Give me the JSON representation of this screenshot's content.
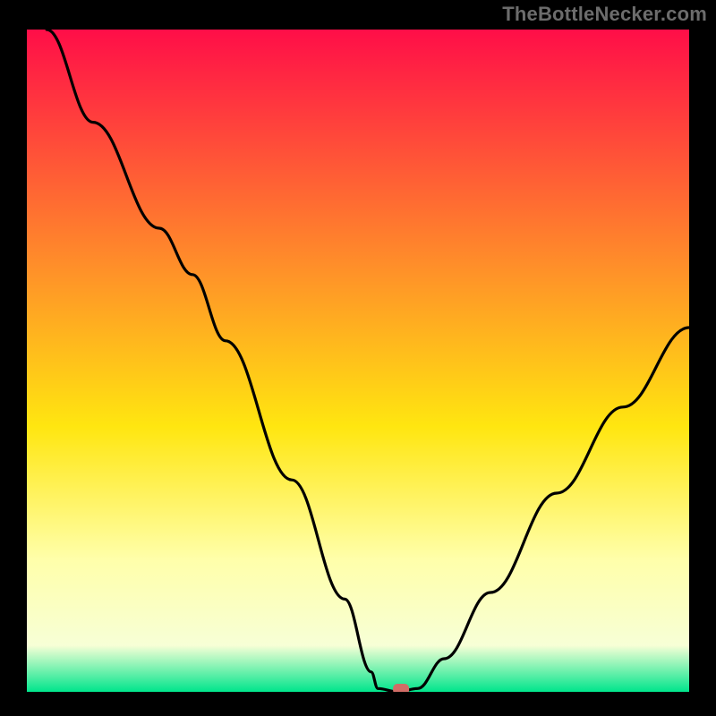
{
  "watermark": "TheBottleNecker.com",
  "colors": {
    "red_top": "#ff0e48",
    "orange": "#ff8c2a",
    "yellow": "#ffe610",
    "pale_yellow": "#ffffaa",
    "cream": "#f7ffd6",
    "green": "#00e58c",
    "curve": "#000000",
    "marker": "#d16c66"
  },
  "chart_data": {
    "type": "line",
    "title": "",
    "xlabel": "",
    "ylabel": "",
    "xlim": [
      0,
      100
    ],
    "ylim": [
      0,
      100
    ],
    "marker": {
      "x": 56.5,
      "y": 0
    },
    "series": [
      {
        "name": "bottleneck-curve",
        "points": [
          {
            "x": 3,
            "y": 100
          },
          {
            "x": 10,
            "y": 86
          },
          {
            "x": 20,
            "y": 70
          },
          {
            "x": 25,
            "y": 63
          },
          {
            "x": 30,
            "y": 53
          },
          {
            "x": 40,
            "y": 32
          },
          {
            "x": 48,
            "y": 14
          },
          {
            "x": 52,
            "y": 3
          },
          {
            "x": 53,
            "y": 0.5
          },
          {
            "x": 56,
            "y": 0
          },
          {
            "x": 59,
            "y": 0.5
          },
          {
            "x": 63,
            "y": 5
          },
          {
            "x": 70,
            "y": 15
          },
          {
            "x": 80,
            "y": 30
          },
          {
            "x": 90,
            "y": 43
          },
          {
            "x": 100,
            "y": 55
          }
        ]
      }
    ]
  }
}
